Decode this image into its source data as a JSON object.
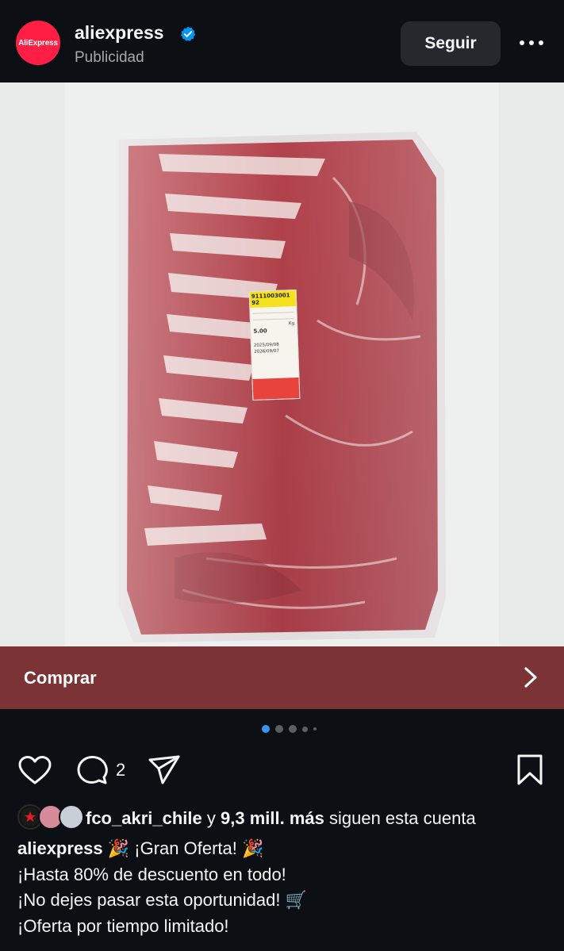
{
  "header": {
    "account_name": "aliexpress",
    "avatar_text": "AliExpress",
    "sponsored_label": "Publicidad",
    "follow_label": "Seguir",
    "verified_icon": "verified-badge-icon",
    "more_icon": "more-options-icon"
  },
  "media": {
    "label_header": "9111003001 92",
    "label_weight": "5.00",
    "label_unit": "Kg",
    "label_date1": "2025/09/08",
    "label_date2": "2026/09/07",
    "image_subject": "vacuum-packed pork belly slab"
  },
  "cta": {
    "label": "Comprar",
    "icon": "chevron-right-icon"
  },
  "carousel": {
    "total": 5,
    "active": 1
  },
  "actions": {
    "like_icon": "heart-icon",
    "comment_icon": "comment-icon",
    "comment_count": "2",
    "share_icon": "send-icon",
    "save_icon": "bookmark-icon"
  },
  "followers": {
    "user": "fco_akri_chile",
    "connector": "y",
    "count": "9,3 mill. más",
    "suffix": "siguen esta cuenta"
  },
  "caption": {
    "account": "aliexpress",
    "line1": "🎉 ¡Gran Oferta! 🎉",
    "line2": " ¡Hasta 80% de descuento en todo!",
    "line3": " ¡No dejes pasar esta oportunidad! 🛒",
    "line4": " ¡Oferta por tiempo limitado!"
  },
  "colors": {
    "background": "#0c1014",
    "cta": "#7b3336",
    "brand": "#ff1f44",
    "verified": "#0095f6"
  }
}
